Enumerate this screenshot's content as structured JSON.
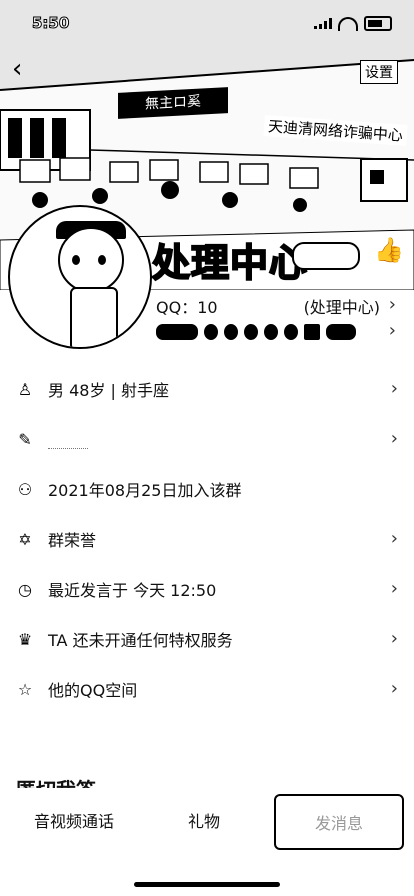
{
  "status": {
    "time": "5:50"
  },
  "header": {
    "settings_label": "设置",
    "sign_1": "無主ロ奚",
    "sign_2": "天迪清网络诈骗中心"
  },
  "profile": {
    "name": "处理中心",
    "qq_label": "QQ：10",
    "qq_suffix": "(处理中心)"
  },
  "rows": [
    {
      "icon": "person-icon",
      "text": "男 48岁 | 射手座"
    },
    {
      "icon": "pencil-icon",
      "text": ""
    },
    {
      "icon": "group-icon",
      "text": "2021年08月25日加入该群"
    },
    {
      "icon": "star-icon",
      "text": "群荣誉"
    },
    {
      "icon": "clock-icon",
      "text": "最近发言于 今天 12:50"
    },
    {
      "icon": "crown-icon",
      "text": "TA 还未开通任何特权服务"
    },
    {
      "icon": "star-outline-icon",
      "text": "他的QQ空间"
    }
  ],
  "section": {
    "title": "匿切我答"
  },
  "bottom": {
    "call_label": "音视频通话",
    "gift_label": "礼物",
    "message_label": "发消息"
  }
}
